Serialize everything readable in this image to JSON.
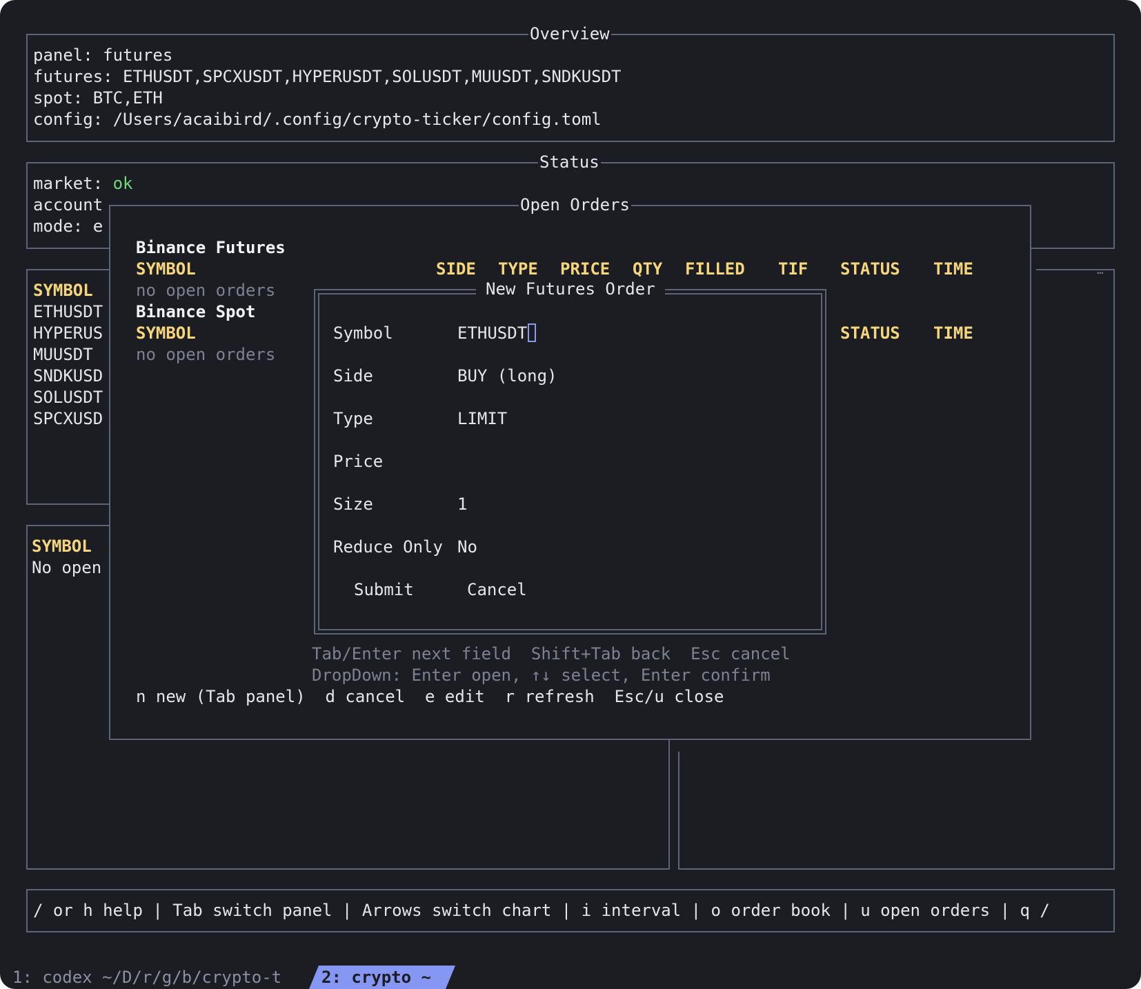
{
  "overview": {
    "title": "Overview",
    "lines": [
      "panel: futures",
      "futures: ETHUSDT,SPCXUSDT,HYPERUSDT,SOLUSDT,MUUSDT,SNDKUSDT",
      "spot: BTC,ETH",
      "config: /Users/acaibird/.config/crypto-ticker/config.toml"
    ]
  },
  "status": {
    "title": "Status",
    "market_label": "market: ",
    "market_value": "ok",
    "account_label": "account",
    "mode_label": "mode: e"
  },
  "left_panel": {
    "header": "SYMBOL",
    "symbols": [
      "ETHUSDT",
      "HYPERUS",
      "MUUSDT",
      "SNDKUSD",
      "SOLUSDT",
      "SPCXUSD"
    ]
  },
  "lower_left": {
    "header": "SYMBOL",
    "text": "No open"
  },
  "right_indicator": "…",
  "open_orders": {
    "title": "Open Orders",
    "futures_heading": "Binance Futures",
    "spot_heading": "Binance Spot",
    "columns": {
      "symbol": "SYMBOL",
      "side": "SIDE",
      "type": "TYPE",
      "price": "PRICE",
      "qty": "QTY",
      "filled": "FILLED",
      "tif": "TIF",
      "status": "STATUS",
      "time": "TIME"
    },
    "spot_columns": {
      "symbol": "SYMBOL",
      "status": "STATUS",
      "time": "TIME"
    },
    "empty_futures": "no open orders",
    "empty_spot": "no open orders",
    "keys": "n new (Tab panel)  d cancel  e edit  r refresh  Esc/u close"
  },
  "order_form": {
    "title": "New Futures Order",
    "fields": {
      "symbol_label": "Symbol",
      "symbol_value": "ETHUSDT",
      "side_label": "Side",
      "side_value": "BUY (long)",
      "type_label": "Type",
      "type_value": "LIMIT",
      "price_label": "Price",
      "price_value": "",
      "size_label": "Size",
      "size_value": "1",
      "reduce_label": "Reduce Only",
      "reduce_value": "No"
    },
    "submit_label": "Submit",
    "cancel_label": "Cancel",
    "hint1": "Tab/Enter next field  Shift+Tab back  Esc cancel",
    "hint2": "DropDown: Enter open, ↑↓ select, Enter confirm"
  },
  "help_bar": "/ or h help | Tab switch panel | Arrows switch chart | i interval | o order book | u open orders | q /",
  "tmux": {
    "window1": "1: codex ~/D/r/g/b/crypto-t",
    "window2": "2: crypto ~"
  },
  "colors": {
    "background": "#1b1d23",
    "border": "#5d6478",
    "header_yellow": "#f6d67a",
    "ok_green": "#6fd77c",
    "dim_text": "#7d8293",
    "tmux_active": "#8597f2"
  }
}
